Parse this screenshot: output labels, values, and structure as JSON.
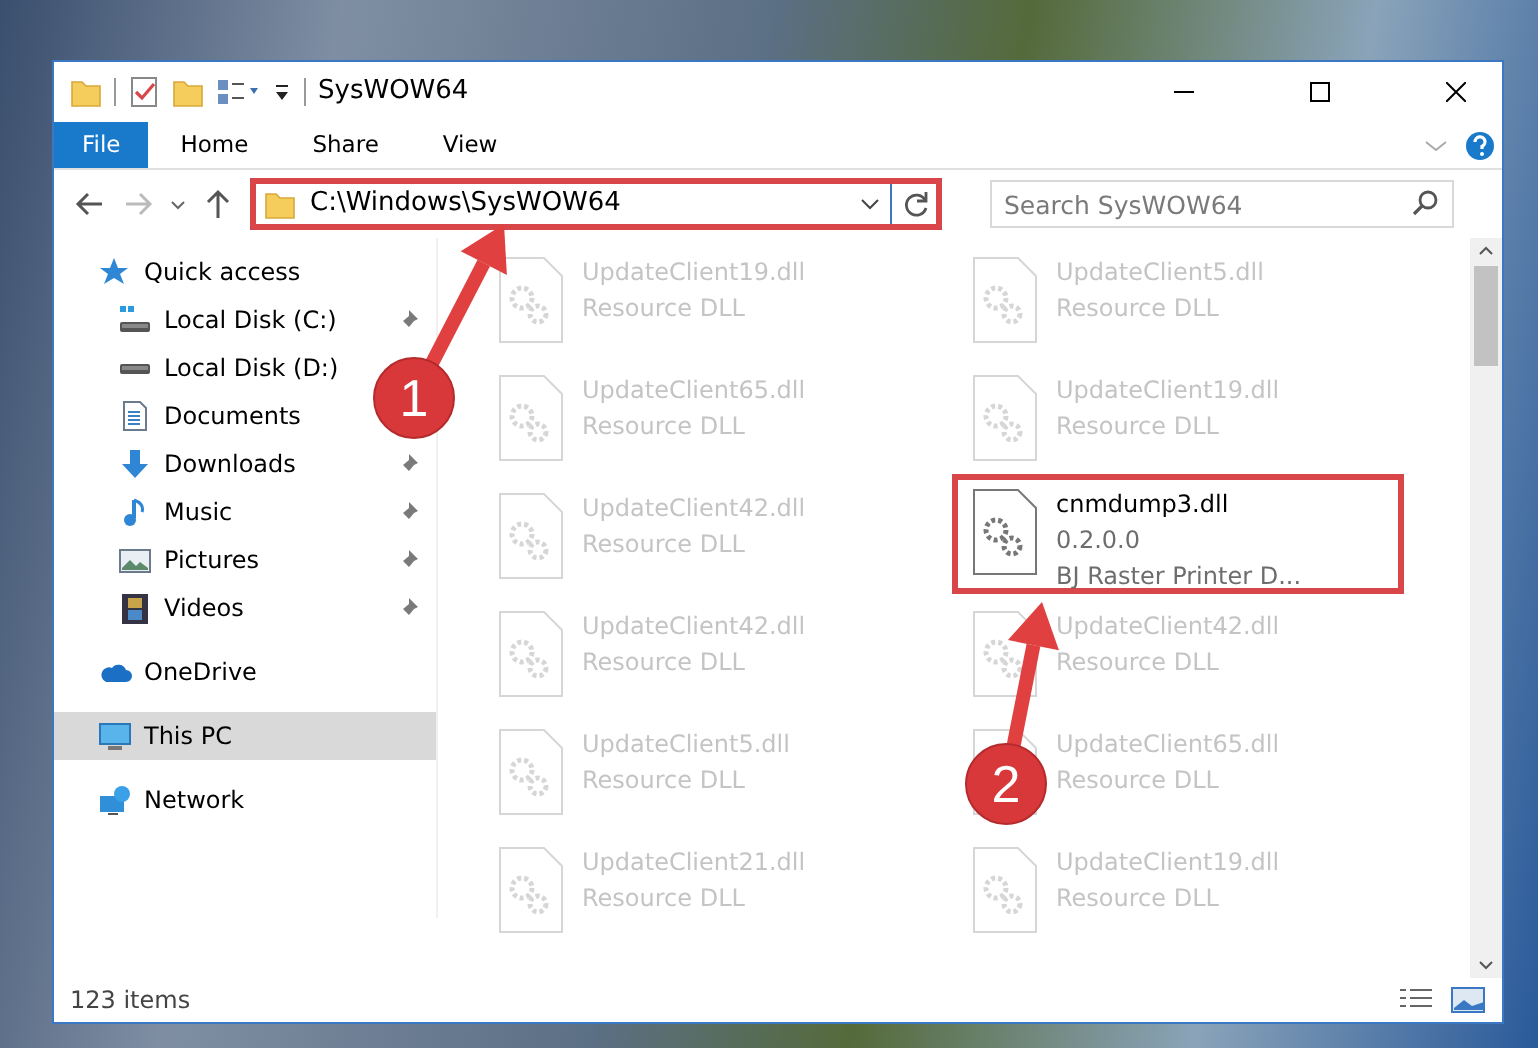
{
  "window": {
    "title": "SysWOW64"
  },
  "ribbon_tabs": [
    {
      "label": "File",
      "selected": true
    },
    {
      "label": "Home",
      "selected": false
    },
    {
      "label": "Share",
      "selected": false
    },
    {
      "label": "View",
      "selected": false
    }
  ],
  "address_bar": {
    "path": "C:\\Windows\\SysWOW64",
    "highlighted": true
  },
  "search": {
    "placeholder": "Search SysWOW64"
  },
  "sidebar": {
    "items": [
      {
        "label": "Quick access",
        "kind": "quick-access",
        "selected": false,
        "children": [
          {
            "label": "Local Disk (C:)",
            "kind": "disk-c",
            "pinned": true,
            "selected": false
          },
          {
            "label": "Local Disk (D:)",
            "kind": "disk",
            "pinned": false,
            "selected": false
          },
          {
            "label": "Documents",
            "kind": "documents",
            "pinned": false,
            "selected": false
          },
          {
            "label": "Downloads",
            "kind": "downloads",
            "pinned": true,
            "selected": false
          },
          {
            "label": "Music",
            "kind": "music",
            "pinned": true,
            "selected": false
          },
          {
            "label": "Pictures",
            "kind": "pictures",
            "pinned": true,
            "selected": false
          },
          {
            "label": "Videos",
            "kind": "videos",
            "pinned": true,
            "selected": false
          }
        ]
      },
      {
        "label": "OneDrive",
        "kind": "onedrive",
        "selected": false
      },
      {
        "label": "This PC",
        "kind": "pc",
        "selected": true
      },
      {
        "label": "Network",
        "kind": "network",
        "selected": false
      }
    ]
  },
  "files": [
    {
      "name": "UpdateClient19.dll",
      "lines": [
        "Resource DLL"
      ],
      "highlighted": false
    },
    {
      "name": "UpdateClient5.dll",
      "lines": [
        "Resource DLL"
      ],
      "highlighted": false
    },
    {
      "name": "UpdateClient65.dll",
      "lines": [
        "Resource DLL"
      ],
      "highlighted": false
    },
    {
      "name": "UpdateClient19.dll",
      "lines": [
        "Resource DLL"
      ],
      "highlighted": false
    },
    {
      "name": "UpdateClient42.dll",
      "lines": [
        "Resource DLL"
      ],
      "highlighted": false
    },
    {
      "name": "cnmdump3.dll",
      "lines": [
        "0.2.0.0",
        "BJ Raster Printer D..."
      ],
      "highlighted": true
    },
    {
      "name": "UpdateClient42.dll",
      "lines": [
        "Resource DLL"
      ],
      "highlighted": false
    },
    {
      "name": "UpdateClient42.dll",
      "lines": [
        "Resource DLL"
      ],
      "highlighted": false
    },
    {
      "name": "UpdateClient5.dll",
      "lines": [
        "Resource DLL"
      ],
      "highlighted": false
    },
    {
      "name": "UpdateClient65.dll",
      "lines": [
        "Resource DLL"
      ],
      "highlighted": false
    },
    {
      "name": "UpdateClient21.dll",
      "lines": [
        "Resource DLL"
      ],
      "highlighted": false
    },
    {
      "name": "UpdateClient19.dll",
      "lines": [
        "Resource DLL"
      ],
      "highlighted": false
    }
  ],
  "status_bar": {
    "item_count": "123 items"
  },
  "annotations": [
    {
      "number": "1"
    },
    {
      "number": "2"
    }
  ]
}
